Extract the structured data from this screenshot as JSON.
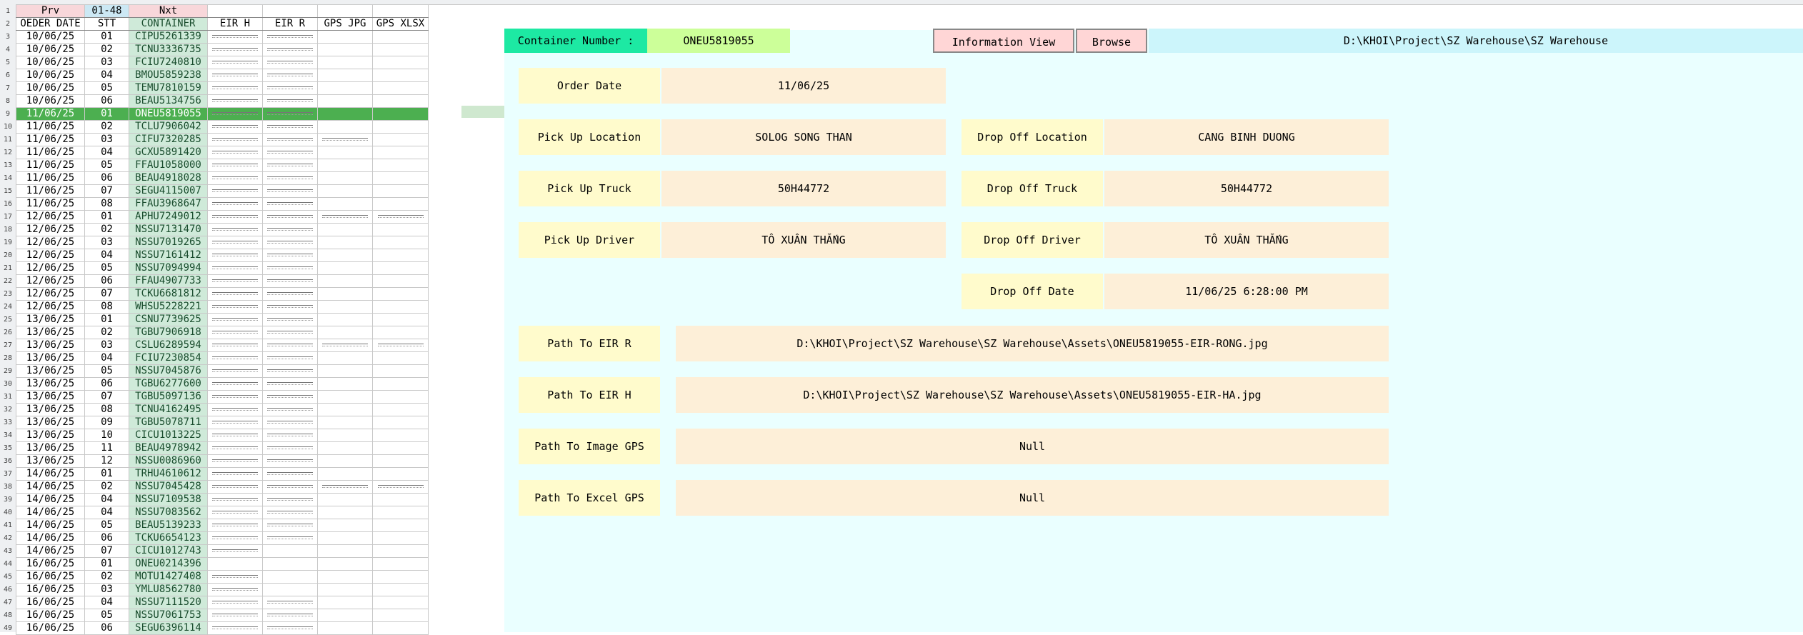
{
  "nav": {
    "prev_label": "Prv",
    "range_label": "01-48",
    "next_label": "Nxt"
  },
  "columns": [
    "OEDER DATE",
    "STT",
    "CONTAINER",
    "EIR H",
    "EIR R",
    "GPS JPG",
    "GPS XLSX"
  ],
  "rows": [
    {
      "date": "10/06/25",
      "stt": "01",
      "container": "CIPU5261339",
      "eir_h": true,
      "eir_r": true,
      "gps_jpg": false,
      "gps_xlsx": false
    },
    {
      "date": "10/06/25",
      "stt": "02",
      "container": "TCNU3336735",
      "eir_h": true,
      "eir_r": true,
      "gps_jpg": false,
      "gps_xlsx": false
    },
    {
      "date": "10/06/25",
      "stt": "03",
      "container": "FCIU7240810",
      "eir_h": true,
      "eir_r": true,
      "gps_jpg": false,
      "gps_xlsx": false
    },
    {
      "date": "10/06/25",
      "stt": "04",
      "container": "BMOU5859238",
      "eir_h": true,
      "eir_r": true,
      "gps_jpg": false,
      "gps_xlsx": false
    },
    {
      "date": "10/06/25",
      "stt": "05",
      "container": "TEMU7810159",
      "eir_h": true,
      "eir_r": true,
      "gps_jpg": false,
      "gps_xlsx": false
    },
    {
      "date": "10/06/25",
      "stt": "06",
      "container": "BEAU5134756",
      "eir_h": true,
      "eir_r": true,
      "gps_jpg": false,
      "gps_xlsx": false
    },
    {
      "date": "11/06/25",
      "stt": "01",
      "container": "ONEU5819055",
      "eir_h": true,
      "eir_r": true,
      "gps_jpg": false,
      "gps_xlsx": false,
      "selected": true
    },
    {
      "date": "11/06/25",
      "stt": "02",
      "container": "TCLU7906042",
      "eir_h": true,
      "eir_r": true,
      "gps_jpg": false,
      "gps_xlsx": false
    },
    {
      "date": "11/06/25",
      "stt": "03",
      "container": "CIFU7320285",
      "eir_h": true,
      "eir_r": true,
      "gps_jpg": true,
      "gps_xlsx": false
    },
    {
      "date": "11/06/25",
      "stt": "04",
      "container": "GCXU5891420",
      "eir_h": true,
      "eir_r": true,
      "gps_jpg": false,
      "gps_xlsx": false
    },
    {
      "date": "11/06/25",
      "stt": "05",
      "container": "FFAU1058000",
      "eir_h": true,
      "eir_r": true,
      "gps_jpg": false,
      "gps_xlsx": false
    },
    {
      "date": "11/06/25",
      "stt": "06",
      "container": "BEAU4918028",
      "eir_h": true,
      "eir_r": true,
      "gps_jpg": false,
      "gps_xlsx": false
    },
    {
      "date": "11/06/25",
      "stt": "07",
      "container": "SEGU4115007",
      "eir_h": true,
      "eir_r": true,
      "gps_jpg": false,
      "gps_xlsx": false
    },
    {
      "date": "11/06/25",
      "stt": "08",
      "container": "FFAU3968647",
      "eir_h": true,
      "eir_r": true,
      "gps_jpg": false,
      "gps_xlsx": false
    },
    {
      "date": "12/06/25",
      "stt": "01",
      "container": "APHU7249012",
      "eir_h": true,
      "eir_r": true,
      "gps_jpg": true,
      "gps_xlsx": true
    },
    {
      "date": "12/06/25",
      "stt": "02",
      "container": "NSSU7131470",
      "eir_h": true,
      "eir_r": true,
      "gps_jpg": false,
      "gps_xlsx": false
    },
    {
      "date": "12/06/25",
      "stt": "03",
      "container": "NSSU7019265",
      "eir_h": true,
      "eir_r": true,
      "gps_jpg": false,
      "gps_xlsx": false
    },
    {
      "date": "12/06/25",
      "stt": "04",
      "container": "NSSU7161412",
      "eir_h": true,
      "eir_r": true,
      "gps_jpg": false,
      "gps_xlsx": false
    },
    {
      "date": "12/06/25",
      "stt": "05",
      "container": "NSSU7094994",
      "eir_h": true,
      "eir_r": true,
      "gps_jpg": false,
      "gps_xlsx": false
    },
    {
      "date": "12/06/25",
      "stt": "06",
      "container": "FFAU4907733",
      "eir_h": true,
      "eir_r": true,
      "gps_jpg": false,
      "gps_xlsx": false
    },
    {
      "date": "12/06/25",
      "stt": "07",
      "container": "TCKU6681812",
      "eir_h": true,
      "eir_r": true,
      "gps_jpg": false,
      "gps_xlsx": false
    },
    {
      "date": "12/06/25",
      "stt": "08",
      "container": "WHSU5228221",
      "eir_h": true,
      "eir_r": true,
      "gps_jpg": false,
      "gps_xlsx": false
    },
    {
      "date": "13/06/25",
      "stt": "01",
      "container": "CSNU7739625",
      "eir_h": true,
      "eir_r": true,
      "gps_jpg": false,
      "gps_xlsx": false
    },
    {
      "date": "13/06/25",
      "stt": "02",
      "container": "TGBU7906918",
      "eir_h": true,
      "eir_r": true,
      "gps_jpg": false,
      "gps_xlsx": false
    },
    {
      "date": "13/06/25",
      "stt": "03",
      "container": "CSLU6289594",
      "eir_h": true,
      "eir_r": true,
      "gps_jpg": true,
      "gps_xlsx": true
    },
    {
      "date": "13/06/25",
      "stt": "04",
      "container": "FCIU7230854",
      "eir_h": true,
      "eir_r": true,
      "gps_jpg": false,
      "gps_xlsx": false
    },
    {
      "date": "13/06/25",
      "stt": "05",
      "container": "NSSU7045876",
      "eir_h": true,
      "eir_r": true,
      "gps_jpg": false,
      "gps_xlsx": false
    },
    {
      "date": "13/06/25",
      "stt": "06",
      "container": "TGBU6277600",
      "eir_h": true,
      "eir_r": true,
      "gps_jpg": false,
      "gps_xlsx": false
    },
    {
      "date": "13/06/25",
      "stt": "07",
      "container": "TGBU5097136",
      "eir_h": true,
      "eir_r": true,
      "gps_jpg": false,
      "gps_xlsx": false
    },
    {
      "date": "13/06/25",
      "stt": "08",
      "container": "TCNU4162495",
      "eir_h": true,
      "eir_r": true,
      "gps_jpg": false,
      "gps_xlsx": false
    },
    {
      "date": "13/06/25",
      "stt": "09",
      "container": "TGBU5078711",
      "eir_h": true,
      "eir_r": true,
      "gps_jpg": false,
      "gps_xlsx": false
    },
    {
      "date": "13/06/25",
      "stt": "10",
      "container": "CICU1013225",
      "eir_h": true,
      "eir_r": true,
      "gps_jpg": false,
      "gps_xlsx": false
    },
    {
      "date": "13/06/25",
      "stt": "11",
      "container": "BEAU4978942",
      "eir_h": true,
      "eir_r": true,
      "gps_jpg": false,
      "gps_xlsx": false
    },
    {
      "date": "13/06/25",
      "stt": "12",
      "container": "NSSU0086960",
      "eir_h": true,
      "eir_r": true,
      "gps_jpg": false,
      "gps_xlsx": false
    },
    {
      "date": "14/06/25",
      "stt": "01",
      "container": "TRHU4610612",
      "eir_h": true,
      "eir_r": true,
      "gps_jpg": false,
      "gps_xlsx": false
    },
    {
      "date": "14/06/25",
      "stt": "02",
      "container": "NSSU7045428",
      "eir_h": true,
      "eir_r": true,
      "gps_jpg": true,
      "gps_xlsx": true
    },
    {
      "date": "14/06/25",
      "stt": "04",
      "container": "NSSU7109538",
      "eir_h": true,
      "eir_r": true,
      "gps_jpg": false,
      "gps_xlsx": false
    },
    {
      "date": "14/06/25",
      "stt": "04",
      "container": "NSSU7083562",
      "eir_h": true,
      "eir_r": true,
      "gps_jpg": false,
      "gps_xlsx": false
    },
    {
      "date": "14/06/25",
      "stt": "05",
      "container": "BEAU5139233",
      "eir_h": true,
      "eir_r": true,
      "gps_jpg": false,
      "gps_xlsx": false
    },
    {
      "date": "14/06/25",
      "stt": "06",
      "container": "TCKU6654123",
      "eir_h": true,
      "eir_r": true,
      "gps_jpg": false,
      "gps_xlsx": false
    },
    {
      "date": "14/06/25",
      "stt": "07",
      "container": "CICU1012743",
      "eir_h": true,
      "eir_r": false,
      "gps_jpg": false,
      "gps_xlsx": false
    },
    {
      "date": "16/06/25",
      "stt": "01",
      "container": "ONEU0214396",
      "eir_h": false,
      "eir_r": false,
      "gps_jpg": false,
      "gps_xlsx": false
    },
    {
      "date": "16/06/25",
      "stt": "02",
      "container": "MOTU1427408",
      "eir_h": true,
      "eir_r": false,
      "gps_jpg": false,
      "gps_xlsx": false
    },
    {
      "date": "16/06/25",
      "stt": "03",
      "container": "YMLU8562780",
      "eir_h": true,
      "eir_r": false,
      "gps_jpg": false,
      "gps_xlsx": false
    },
    {
      "date": "16/06/25",
      "stt": "04",
      "container": "NSSU7111520",
      "eir_h": true,
      "eir_r": true,
      "gps_jpg": false,
      "gps_xlsx": false
    },
    {
      "date": "16/06/25",
      "stt": "05",
      "container": "NSSU7061753",
      "eir_h": true,
      "eir_r": true,
      "gps_jpg": false,
      "gps_xlsx": false
    },
    {
      "date": "16/06/25",
      "stt": "06",
      "container": "SEGU6396114",
      "eir_h": true,
      "eir_r": true,
      "gps_jpg": false,
      "gps_xlsx": false
    }
  ],
  "form": {
    "container_number_label": "Container Number :",
    "container_number_value": "ONEU5819055",
    "info_view_label": "Information View",
    "browse_label": "Browse",
    "folder_path": "D:\\KHOI\\Project\\SZ Warehouse\\SZ Warehouse",
    "order_date_label": "Order Date",
    "order_date_value": "11/06/25",
    "pickup_location_label": "Pick Up Location",
    "pickup_location_value": "SOLOG SONG THAN",
    "dropoff_location_label": "Drop Off Location",
    "dropoff_location_value": "CANG BINH DUONG",
    "pickup_truck_label": "Pick Up Truck",
    "pickup_truck_value": "50H44772",
    "dropoff_truck_label": "Drop Off Truck",
    "dropoff_truck_value": "50H44772",
    "pickup_driver_label": "Pick Up Driver",
    "pickup_driver_value": "TÔ XUÂN THẮNG",
    "dropoff_driver_label": "Drop Off Driver",
    "dropoff_driver_value": "TÔ XUÂN THẮNG",
    "dropoff_date_label": "Drop Off Date",
    "dropoff_date_value": "11/06/25 6:28:00 PM",
    "path_eir_r_label": "Path To EIR R",
    "path_eir_r_value": "D:\\KHOI\\Project\\SZ Warehouse\\SZ Warehouse\\Assets\\ONEU5819055-EIR-RONG.jpg",
    "path_eir_h_label": "Path To EIR H",
    "path_eir_h_value": "D:\\KHOI\\Project\\SZ Warehouse\\SZ Warehouse\\Assets\\ONEU5819055-EIR-HA.jpg",
    "path_gps_image_label": "Path To Image GPS",
    "path_gps_image_value": "Null",
    "path_gps_excel_label": "Path To Excel GPS",
    "path_gps_excel_value": "Null"
  },
  "colors": {
    "container_label_bg": "#1de9a3",
    "container_value_bg": "#ccff99",
    "button_bg": "#ffd6d6",
    "path_bar_bg": "#ccf5fb",
    "label_bg": "#fffbcc",
    "value_bg": "#fdefd8",
    "panel_bg": "#eaffff",
    "selected_row": "#4caf50"
  }
}
